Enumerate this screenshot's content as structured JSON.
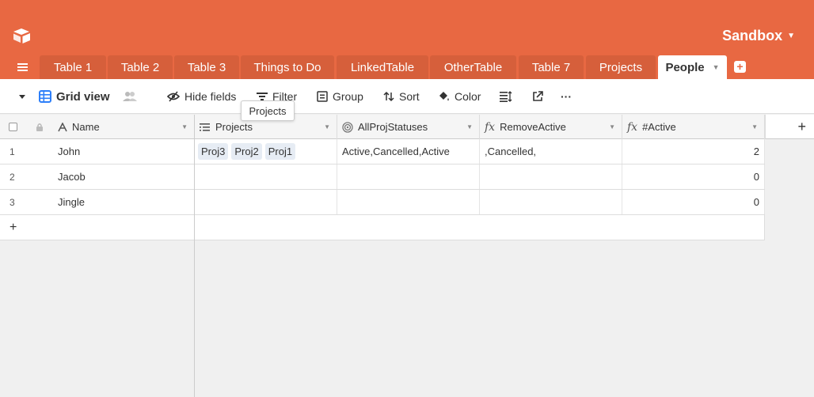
{
  "header": {
    "base_name": "Sandbox",
    "tabs": [
      "Table 1",
      "Table 2",
      "Table 3",
      "Things to Do",
      "LinkedTable",
      "OtherTable",
      "Table 7",
      "Projects",
      "People"
    ],
    "active_tab": "People"
  },
  "toolbar": {
    "view_name": "Grid view",
    "hide_fields": "Hide fields",
    "filter": "Filter",
    "group": "Group",
    "sort": "Sort",
    "color": "Color",
    "more": "···"
  },
  "tooltip": "Projects",
  "grid": {
    "columns": [
      "Name",
      "Projects",
      "AllProjStatuses",
      "RemoveActive",
      "#Active"
    ],
    "rows": [
      {
        "num": "1",
        "name": "John",
        "projects": [
          "Proj3",
          "Proj2",
          "Proj1"
        ],
        "all_statuses": "Active,Cancelled,Active",
        "remove_active": ",Cancelled,",
        "active_count": "2"
      },
      {
        "num": "2",
        "name": "Jacob",
        "projects": [],
        "all_statuses": "",
        "remove_active": "",
        "active_count": "0"
      },
      {
        "num": "3",
        "name": "Jingle",
        "projects": [],
        "all_statuses": "",
        "remove_active": "",
        "active_count": "0"
      }
    ],
    "add_row": "+",
    "add_column": "+"
  },
  "colors": {
    "header_bg": "#e86842",
    "tab_bg": "#d65f3b",
    "chip_bg": "#e6ecf4"
  }
}
